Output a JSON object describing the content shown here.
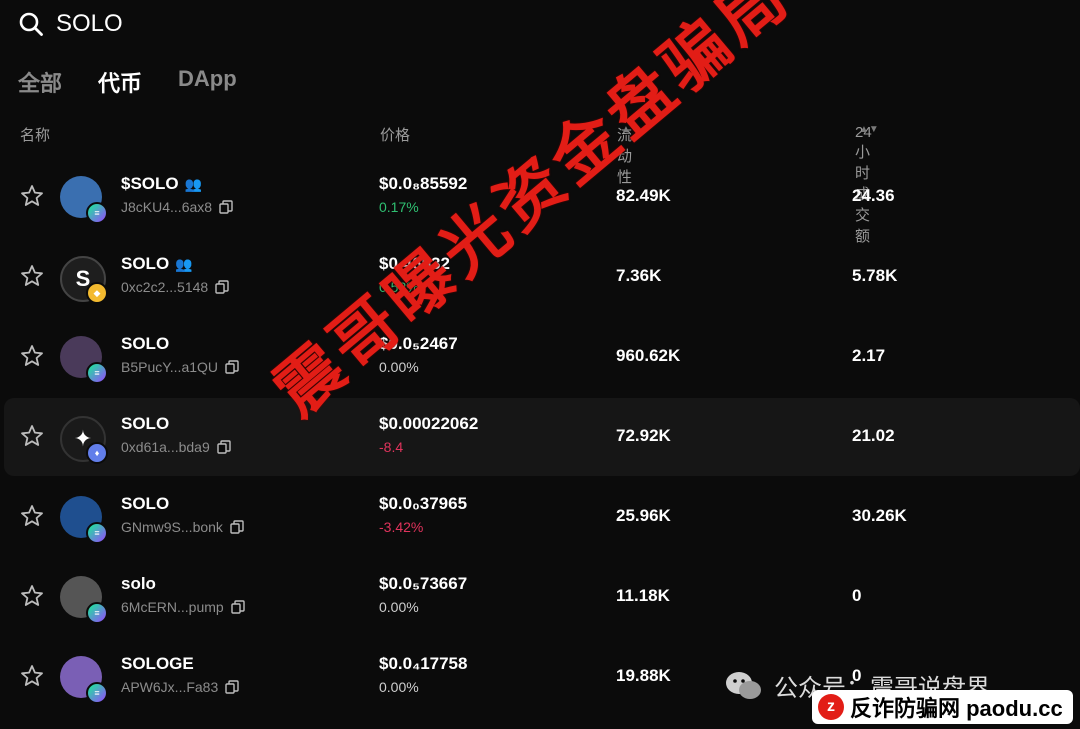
{
  "search": {
    "value": "SOLO"
  },
  "tabs": [
    {
      "label": "全部",
      "active": false
    },
    {
      "label": "代币",
      "active": true
    },
    {
      "label": "DApp",
      "active": false
    }
  ],
  "columns": {
    "name": "名称",
    "price": "价格",
    "liquidity": "流动性",
    "volume": "24小时成交额"
  },
  "rows": [
    {
      "name": "$SOLO",
      "address": "J8cKU4...6ax8",
      "price": "$0.0₈85592",
      "change": "0.17%",
      "liquidity": "82.49K",
      "volume": "24.36",
      "chain": "solana"
    },
    {
      "name": "SOLO",
      "address": "0xc2c2...5148",
      "price": "$0.46532",
      "change": "0.52%",
      "liquidity": "7.36K",
      "volume": "5.78K",
      "chain": "bnb"
    },
    {
      "name": "SOLO",
      "address": "B5PucY...a1QU",
      "price": "$0.0₅2467",
      "change": "0.00%",
      "liquidity": "960.62K",
      "volume": "2.17",
      "chain": "solana"
    },
    {
      "name": "SOLO",
      "address": "0xd61a...bda9",
      "price": "$0.00022062",
      "change": "-8.4",
      "liquidity": "72.92K",
      "volume": "21.02",
      "chain": "ethereum"
    },
    {
      "name": "SOLO",
      "address": "GNmw9S...bonk",
      "price": "$0.0₀37965",
      "change": "-3.42%",
      "liquidity": "25.96K",
      "volume": "30.26K",
      "chain": "solana"
    },
    {
      "name": "solo",
      "address": "6McERN...pump",
      "price": "$0.0₅73667",
      "change": "0.00%",
      "liquidity": "11.18K",
      "volume": "0",
      "chain": "solana"
    },
    {
      "name": "SOLOGE",
      "address": "APW6Jx...Fa83",
      "price": "$0.0₄17758",
      "change": "0.00%",
      "liquidity": "19.88K",
      "volume": "0",
      "chain": "solana"
    }
  ],
  "watermark": "震哥曝光资金盘骗局",
  "footer": {
    "wechat": "公众号：震哥说盘界",
    "site": "反诈防骗网 paodu.cc"
  }
}
